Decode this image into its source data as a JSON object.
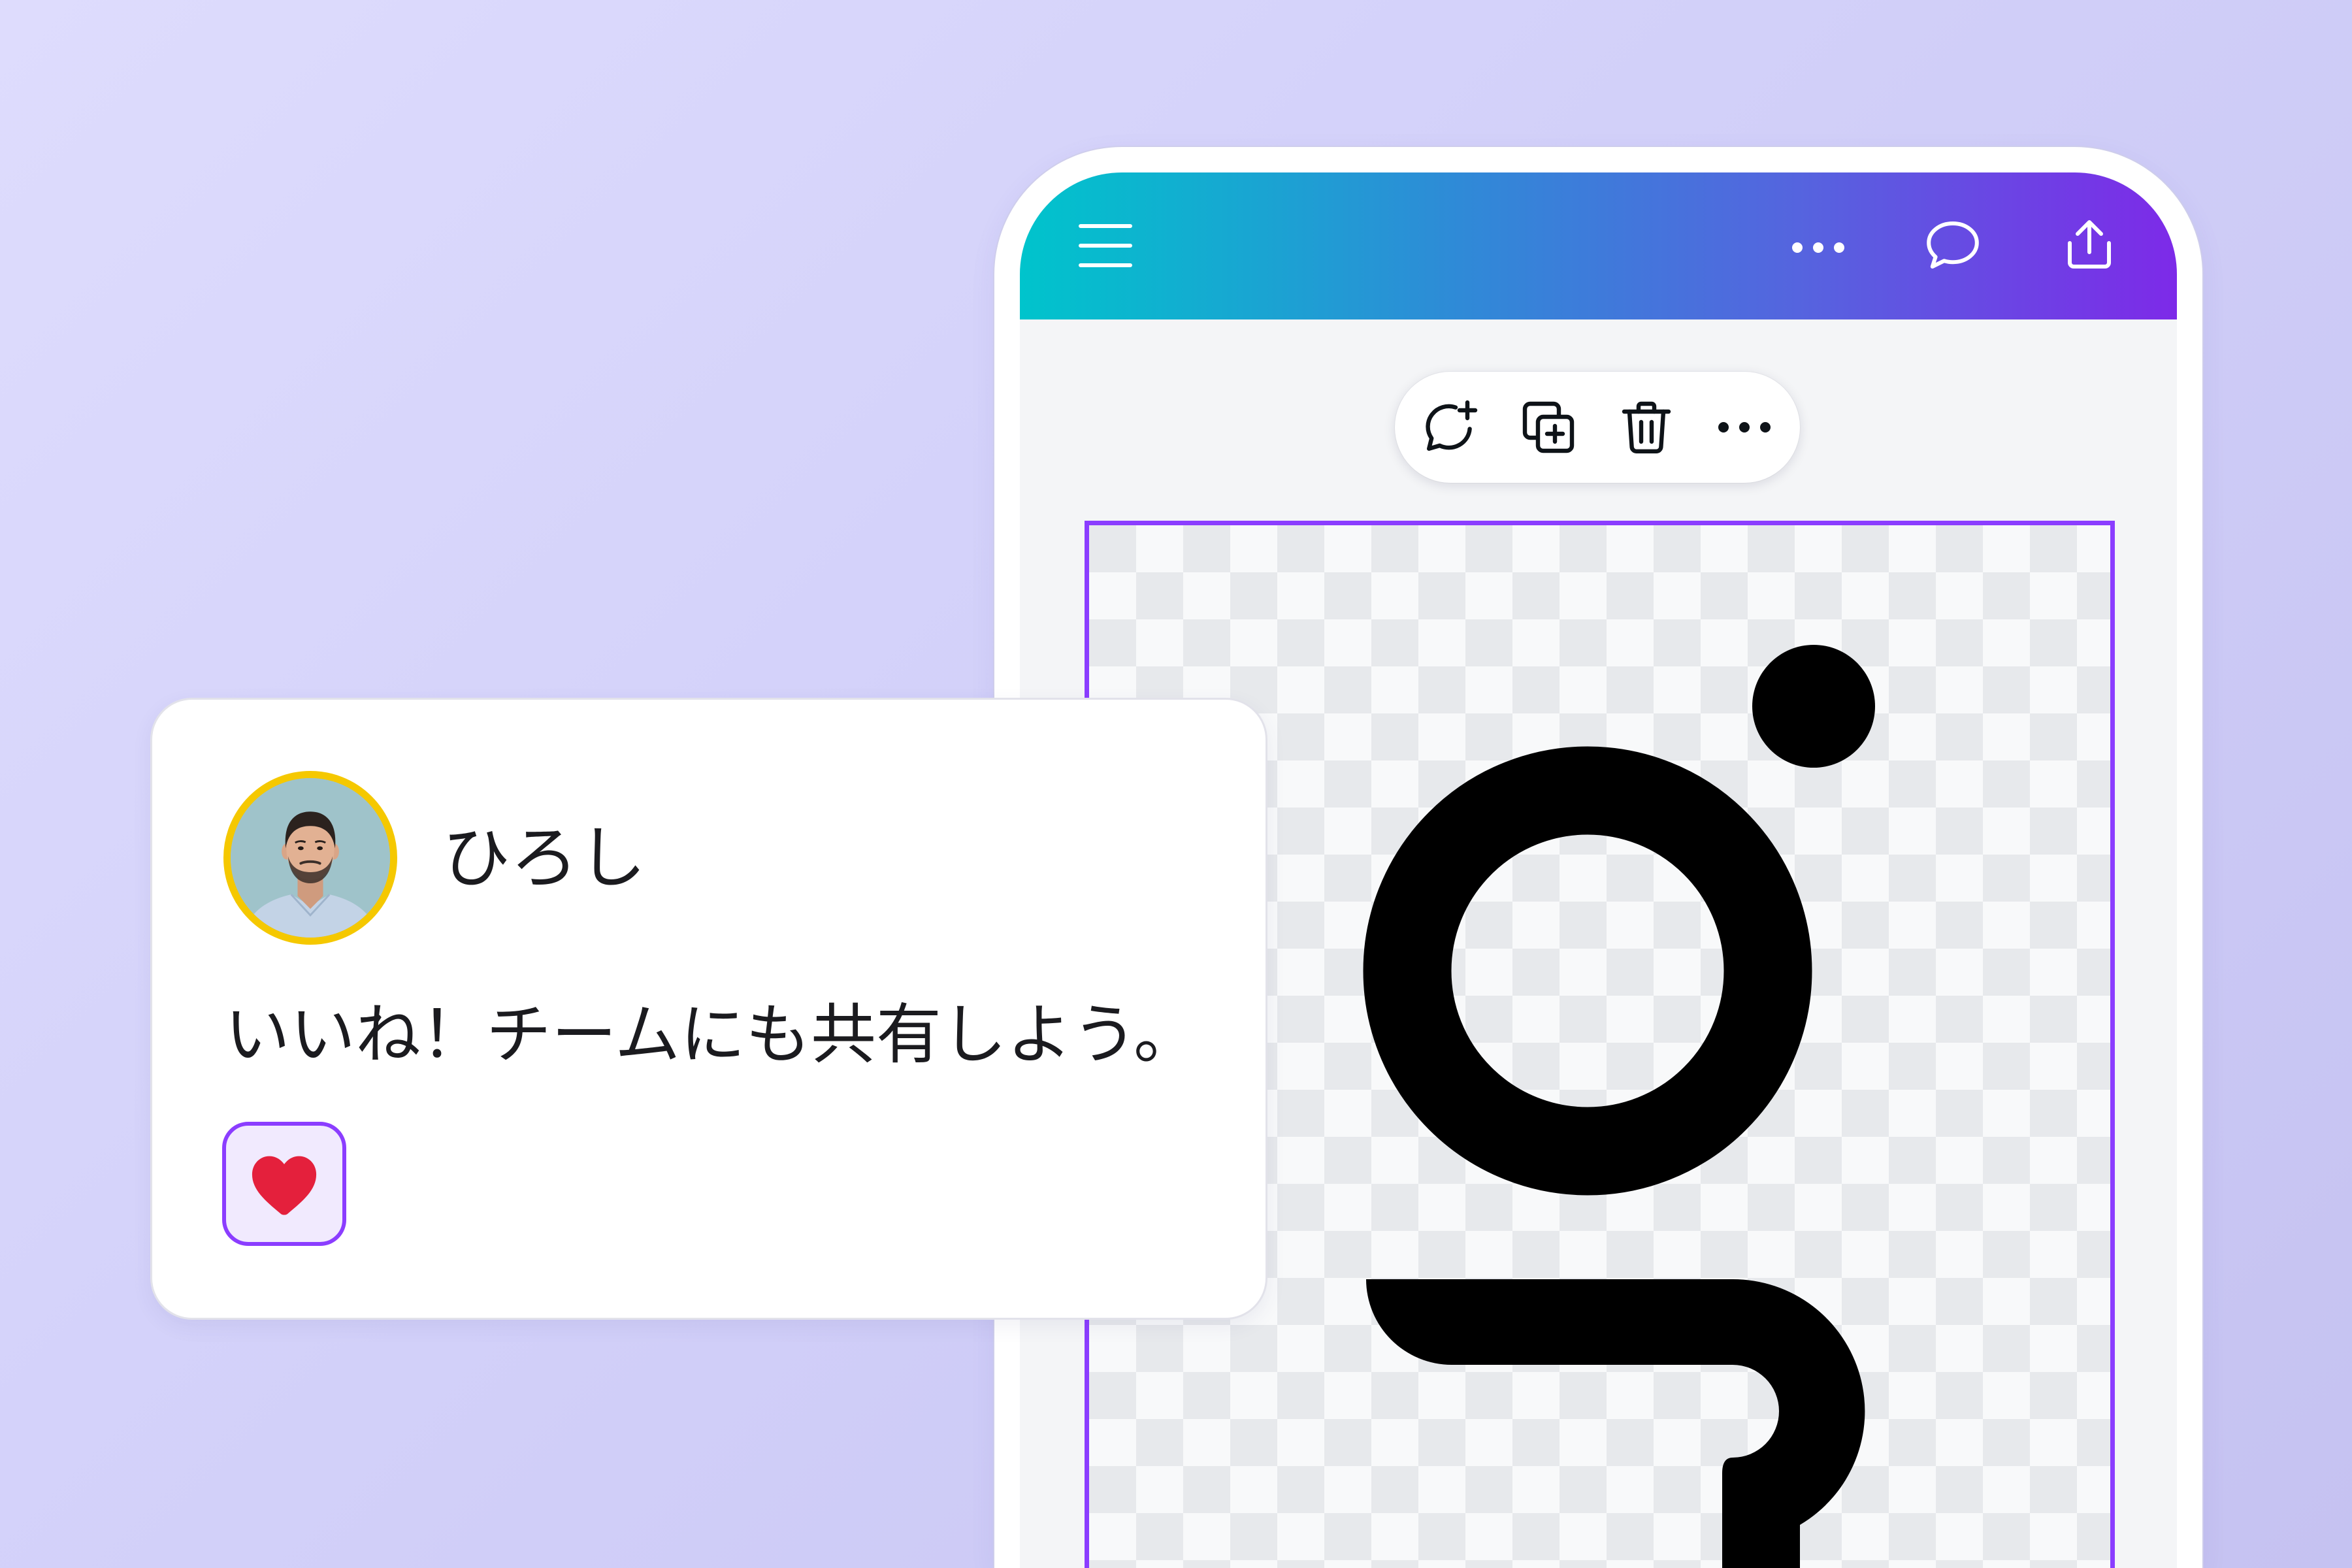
{
  "header": {
    "icons": {
      "menu": "hamburger-menu-icon",
      "more": "more-horizontal-icon",
      "comments": "comment-icon",
      "share": "share-icon"
    },
    "gradient": [
      "#00c4cc",
      "#7d2ae8"
    ]
  },
  "element_toolbar": {
    "icons": [
      "add-comment-icon",
      "duplicate-icon",
      "delete-trash-icon",
      "more-horizontal-icon"
    ]
  },
  "canvas": {
    "selection_color": "#8b3dff",
    "graphic_color": "#000000",
    "background": "transparent-checkerboard"
  },
  "comment": {
    "author": "ひろし",
    "message": "いいね！チームにも共有しよう。",
    "avatar_ring_color": "#f5c800",
    "reaction": {
      "icon": "heart-icon",
      "color": "#e4203c",
      "selected": true
    }
  },
  "colors": {
    "background": "#d2d0f9",
    "accent": "#8b3dff",
    "text": "#1b1b1f"
  }
}
